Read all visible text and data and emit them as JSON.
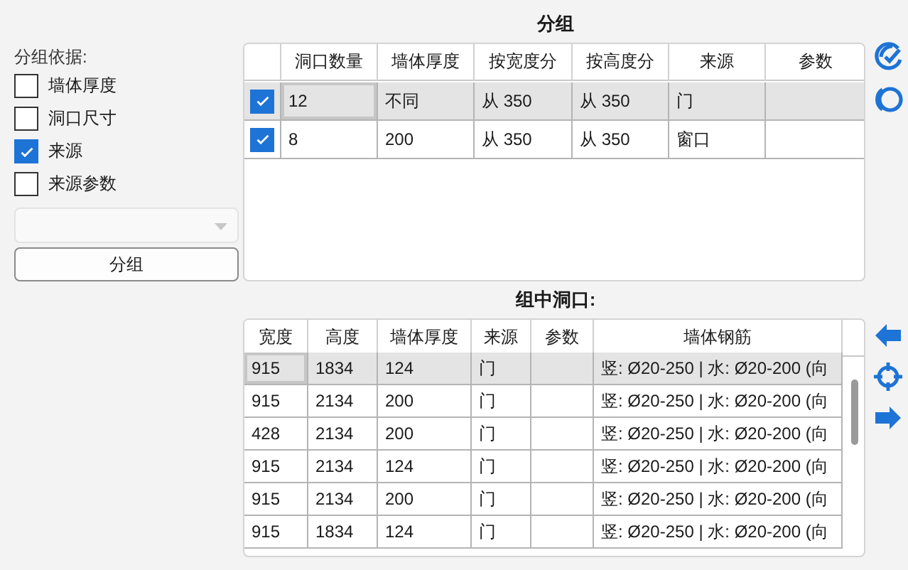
{
  "group_by": {
    "label": "分组依据:",
    "options": [
      {
        "label": "墙体厚度",
        "checked": false
      },
      {
        "label": "洞口尺寸",
        "checked": false
      },
      {
        "label": "来源",
        "checked": true
      },
      {
        "label": "来源参数",
        "checked": false
      }
    ],
    "dropdown": {
      "disabled": true
    },
    "button": "分组"
  },
  "groups": {
    "title": "分组",
    "columns": [
      "洞口数量",
      "墙体厚度",
      "按宽度分",
      "按高度分",
      "来源",
      "参数"
    ],
    "rows": [
      {
        "checked": true,
        "selected": true,
        "cells": [
          "12",
          "不同",
          "从 350",
          "从 350",
          "门",
          ""
        ]
      },
      {
        "checked": true,
        "selected": false,
        "cells": [
          "8",
          "200",
          "从 350",
          "从 350",
          "窗口",
          ""
        ]
      }
    ]
  },
  "openings": {
    "title": "组中洞口:",
    "columns": [
      "宽度",
      "高度",
      "墙体厚度",
      "来源",
      "参数",
      "墙体钢筋"
    ],
    "rows": [
      {
        "selected": true,
        "cells": [
          "915",
          "1834",
          "124",
          "门",
          "",
          "竖: Ø20-250 | 水: Ø20-200 (向"
        ]
      },
      {
        "selected": false,
        "cells": [
          "915",
          "2134",
          "200",
          "门",
          "",
          "竖: Ø20-250 | 水: Ø20-200 (向"
        ]
      },
      {
        "selected": false,
        "cells": [
          "428",
          "2134",
          "200",
          "门",
          "",
          "竖: Ø20-250 | 水: Ø20-200 (向"
        ]
      },
      {
        "selected": false,
        "cells": [
          "915",
          "2134",
          "124",
          "门",
          "",
          "竖: Ø20-250 | 水: Ø20-200 (向"
        ]
      },
      {
        "selected": false,
        "cells": [
          "915",
          "2134",
          "200",
          "门",
          "",
          "竖: Ø20-250 | 水: Ø20-200 (向"
        ]
      },
      {
        "selected": false,
        "cells": [
          "915",
          "1834",
          "124",
          "门",
          "",
          "竖: Ø20-250 | 水: Ø20-200 (向"
        ]
      }
    ]
  }
}
